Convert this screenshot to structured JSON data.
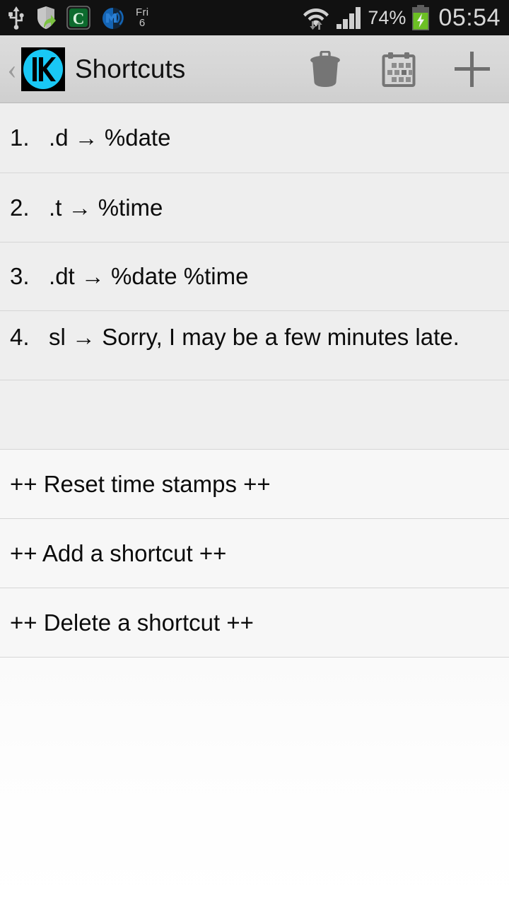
{
  "status_bar": {
    "left_icons": [
      {
        "name": "usb-icon",
        "label": "USB"
      },
      {
        "name": "shield-security-icon",
        "label": "Security"
      },
      {
        "name": "c-app-icon",
        "label": "C"
      },
      {
        "name": "m-wireless-icon",
        "label": "M"
      }
    ],
    "date": {
      "weekday": "Fri",
      "day": "6"
    },
    "wifi_icon": "wifi-data-transfer-icon",
    "signal_icon": "cellular-signal-icon",
    "battery_percent": "74%",
    "battery_icon": "battery-charging-icon",
    "clock": "05:54",
    "colors": {
      "background": "#111111",
      "text": "#d8d8d8",
      "battery_green": "#6cc024"
    }
  },
  "action_bar": {
    "back_label": "‹",
    "app_icon_name": "kyocera-k-app-icon",
    "title": "Shortcuts",
    "actions": [
      {
        "name": "delete-icon",
        "label": "Delete"
      },
      {
        "name": "calendar-icon",
        "label": "Calendar"
      },
      {
        "name": "add-icon",
        "label": "Add"
      }
    ],
    "colors": {
      "background": "#d6d6d6",
      "title": "#101010",
      "icon": "#757575",
      "accent": "#19c8f5"
    }
  },
  "list": {
    "shortcuts": [
      {
        "index": "1.",
        "trigger": ".d",
        "arrow": "→",
        "expansion": "%date",
        "text": "1.   .d → %date"
      },
      {
        "index": "2.",
        "trigger": ".t",
        "arrow": "→",
        "expansion": "%time",
        "text": "2.   .t → %time"
      },
      {
        "index": "3.",
        "trigger": ".dt",
        "arrow": "→",
        "expansion": "%date %time",
        "text": "3.   .dt → %date %time"
      },
      {
        "index": "4.",
        "trigger": "sl",
        "arrow": "→",
        "expansion": "Sorry, I may be a few minutes late.",
        "text": "4.   sl → Sorry, I may be a few minutes late."
      }
    ],
    "blank_row": "",
    "actions": [
      {
        "label": "++ Reset time stamps ++"
      },
      {
        "label": "++ Add a shortcut ++"
      },
      {
        "label": "++ Delete a shortcut ++"
      }
    ]
  }
}
